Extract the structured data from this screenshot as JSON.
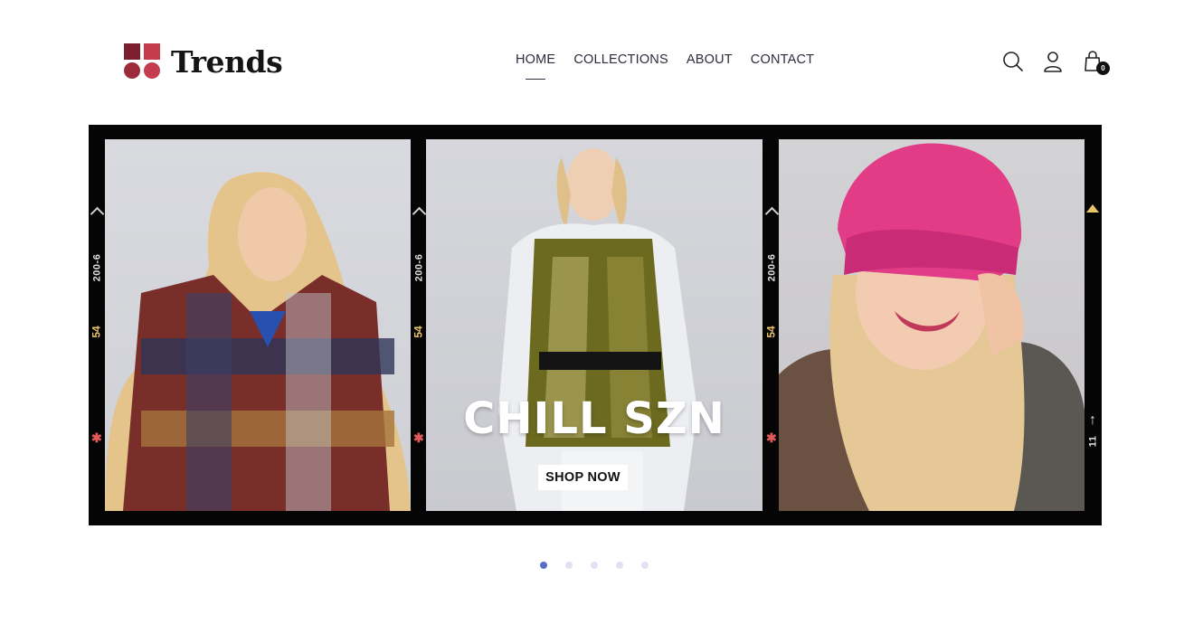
{
  "brand": {
    "name": "Trends",
    "logo_colors": [
      "#7a1f2b",
      "#c43c4e"
    ]
  },
  "nav": {
    "items": [
      {
        "label": "HOME",
        "active": true
      },
      {
        "label": "COLLECTIONS",
        "active": false
      },
      {
        "label": "ABOUT",
        "active": false
      },
      {
        "label": "CONTACT",
        "active": false
      }
    ]
  },
  "header_icons": {
    "search": "search-icon",
    "account": "user-icon",
    "cart": "shopping-bag-icon",
    "cart_count": "0"
  },
  "hero": {
    "headline": "CHILL SZN",
    "cta_label": "SHOP NOW",
    "film_markers": {
      "code": "200-6",
      "frame_number": "54",
      "edge_number": "11"
    },
    "slides": [
      {
        "description": "model-in-plaid-coat-photo"
      },
      {
        "description": "model-in-metallic-puffer-vest-photo"
      },
      {
        "description": "model-in-pink-beanie-photo"
      }
    ]
  },
  "carousel": {
    "total_slides": 5,
    "active_index": 0
  },
  "colors": {
    "accent": "#5b6ec7",
    "dot_inactive": "#dfe2f3",
    "text": "#2c2c3d",
    "film_yellow": "#e7c36a"
  }
}
